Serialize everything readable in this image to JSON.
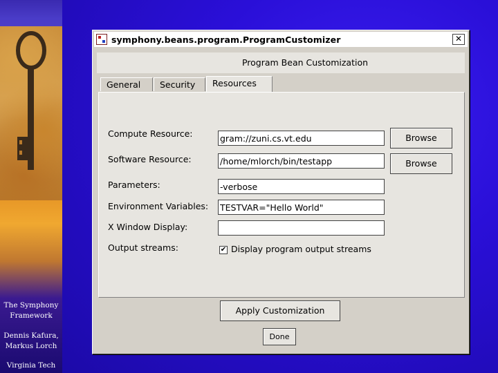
{
  "slide": {
    "caption_title": [
      "The Symphony",
      "Framework"
    ],
    "caption_authors": [
      "Dennis Kafura,",
      "Markus Lorch"
    ],
    "caption_org": "Virginia Tech"
  },
  "window": {
    "title": "symphony.beans.program.ProgramCustomizer",
    "close_glyph": "✕",
    "heading": "Program Bean Customization",
    "tabs": [
      {
        "label": "General",
        "active": false
      },
      {
        "label": "Security",
        "active": false
      },
      {
        "label": "Resources",
        "active": true
      }
    ],
    "fields": {
      "compute_resource": {
        "label": "Compute Resource:",
        "value": "gram://zuni.cs.vt.edu"
      },
      "software_resource": {
        "label": "Software Resource:",
        "value": "/home/mlorch/bin/testapp"
      },
      "parameters": {
        "label": "Parameters:",
        "value": "-verbose"
      },
      "environment_variables": {
        "label": "Environment Variables:",
        "value": "TESTVAR=\"Hello World\""
      },
      "x_window_display": {
        "label": "X Window Display:",
        "value": ""
      }
    },
    "browse_label": "Browse",
    "output_streams": {
      "label": "Output streams:",
      "checkbox_label": "Display program output streams",
      "checked": true,
      "check_glyph": "✔"
    },
    "apply_label": "Apply Customization",
    "done_label": "Done"
  },
  "icons": [
    "app-icon",
    "close-icon",
    "checkbox-check-icon"
  ]
}
